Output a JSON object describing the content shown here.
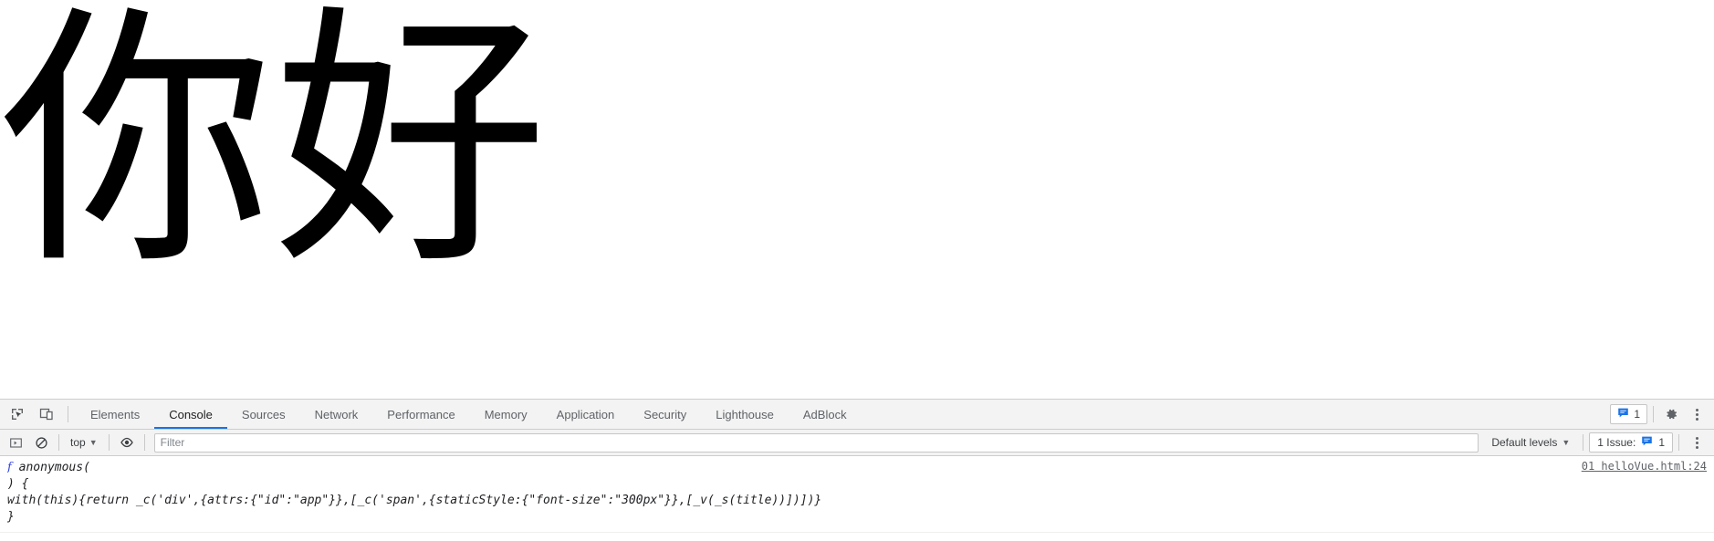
{
  "page": {
    "app_id": "app",
    "title_text": "你好",
    "font_size": "300px"
  },
  "devtools": {
    "tool_icons": [
      {
        "name": "inspect-element-icon",
        "label": "Inspect element"
      },
      {
        "name": "device-toolbar-icon",
        "label": "Toggle device toolbar"
      }
    ],
    "tabs": [
      {
        "label": "Elements",
        "active": false
      },
      {
        "label": "Console",
        "active": true
      },
      {
        "label": "Sources",
        "active": false
      },
      {
        "label": "Network",
        "active": false
      },
      {
        "label": "Performance",
        "active": false
      },
      {
        "label": "Memory",
        "active": false
      },
      {
        "label": "Application",
        "active": false
      },
      {
        "label": "Security",
        "active": false
      },
      {
        "label": "Lighthouse",
        "active": false
      },
      {
        "label": "AdBlock",
        "active": false
      }
    ],
    "tabbar_right": {
      "issues_count": "1",
      "settings_label": "Settings",
      "more_label": "Customize and control DevTools"
    },
    "console_toolbar": {
      "sidebar_toggle": "console-sidebar-icon",
      "clear_label": "Clear console",
      "context": "top",
      "eye_label": "Create live expression",
      "filter_placeholder": "Filter",
      "filter_value": "",
      "levels": "Default levels",
      "issue_text": "1 Issue:",
      "issue_count": "1"
    },
    "messages": [
      {
        "glyph": "ƒ",
        "line1": " anonymous(",
        "line2": ") {",
        "line3": "with(this){return _c('div',{attrs:{\"id\":\"app\"}},[_c('span',{staticStyle:{\"font-size\":\"300px\"}},[_v(_s(title))])])}",
        "line4": "}",
        "source": "01 helloVue.html:24"
      }
    ]
  },
  "colors": {
    "accent_blue": "#1a73e8",
    "toolbar_bg": "#f3f3f3",
    "border": "#cdcdcd",
    "text": "#5f6368",
    "fn_blue": "#3344dd"
  }
}
